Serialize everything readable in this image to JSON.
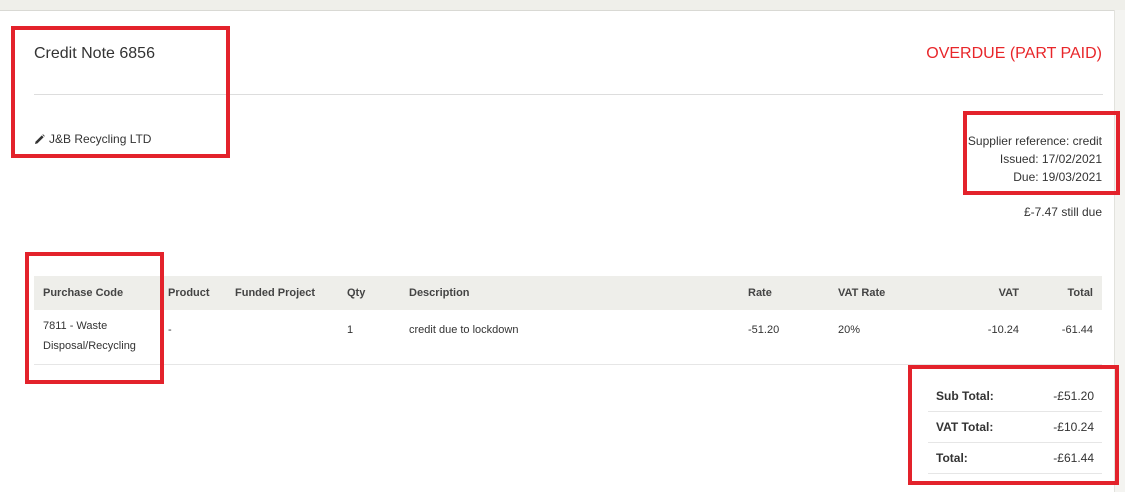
{
  "header": {
    "title": "Credit Note 6856",
    "status": "OVERDUE (PART PAID)",
    "supplier": "J&B Recycling LTD"
  },
  "meta": {
    "supplier_reference": "Supplier reference: credit",
    "issued": "Issued: 17/02/2021",
    "due": "Due: 19/03/2021",
    "still_due": "£-7.47 still due"
  },
  "table": {
    "columns": [
      "Purchase Code",
      "Product",
      "Funded Project",
      "Qty",
      "Description",
      "Rate",
      "VAT Rate",
      "VAT",
      "Total"
    ],
    "rows": [
      {
        "purchase_code_line1": "7811 - Waste",
        "purchase_code_line2": "Disposal/Recycling",
        "product": "-",
        "funded_project": "",
        "qty": "1",
        "description": "credit due to lockdown",
        "rate": "-51.20",
        "vat_rate": "20%",
        "vat": "-10.24",
        "total": "-61.44"
      }
    ]
  },
  "totals": {
    "sub_total_label": "Sub Total:",
    "sub_total_value": "-£51.20",
    "vat_total_label": "VAT Total:",
    "vat_total_value": "-£10.24",
    "total_label": "Total:",
    "total_value": "-£61.44"
  },
  "colors": {
    "status": "#e8262a",
    "highlight": "#e3222b",
    "table_header_bg": "#eeeeea"
  },
  "icons": {
    "supplier": "pencil-icon"
  }
}
